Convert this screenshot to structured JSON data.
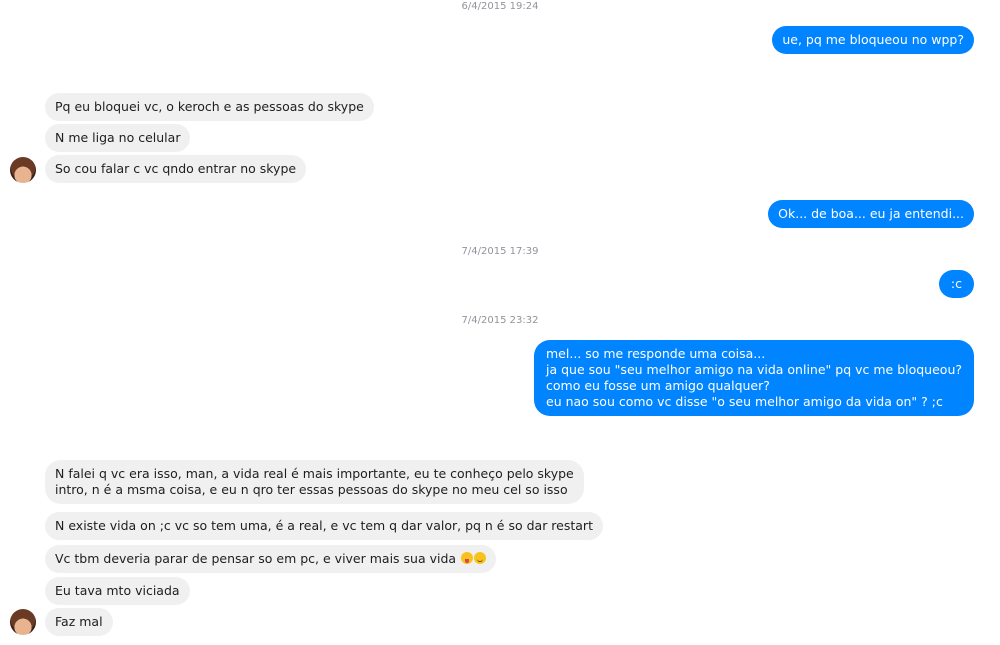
{
  "timestamps": [
    "6/4/2015 19:24",
    "7/4/2015 17:39",
    "7/4/2015 23:32"
  ],
  "messages": [
    "ue, pq me bloqueou no wpp?",
    "Pq eu bloquei vc, o keroch e as pessoas do skype",
    "N me liga no celular",
    "So cou falar c vc qndo entrar no skype",
    "Ok... de boa... eu ja entendi...",
    ":c",
    "mel... so me responde uma coisa...\nja que sou \"seu melhor amigo na vida online\" pq vc me bloqueou?\ncomo eu fosse um amigo qualquer?\neu nao sou como vc disse \"o seu melhor amigo da vida on\" ? ;c",
    "N falei q vc era isso, man, a vida real é mais importante, eu te conheço pelo skype\nintro, n é a msma coisa, e eu n qro ter essas pessoas do skype no meu cel so isso",
    "N existe vida on ;c vc so tem uma, é a real, e vc tem q dar valor, pq n é so dar restart",
    "Vc tbm deveria parar de pensar so em pc, e viver mais sua vida",
    "Eu tava mto viciada",
    "Faz mal"
  ],
  "emojis": [
    "face-with-tongue-icon",
    "winking-face-icon"
  ],
  "colors": {
    "outgoing_bubble": "#0084ff",
    "incoming_bubble": "#f1f0f0",
    "timestamp": "#90949c"
  }
}
